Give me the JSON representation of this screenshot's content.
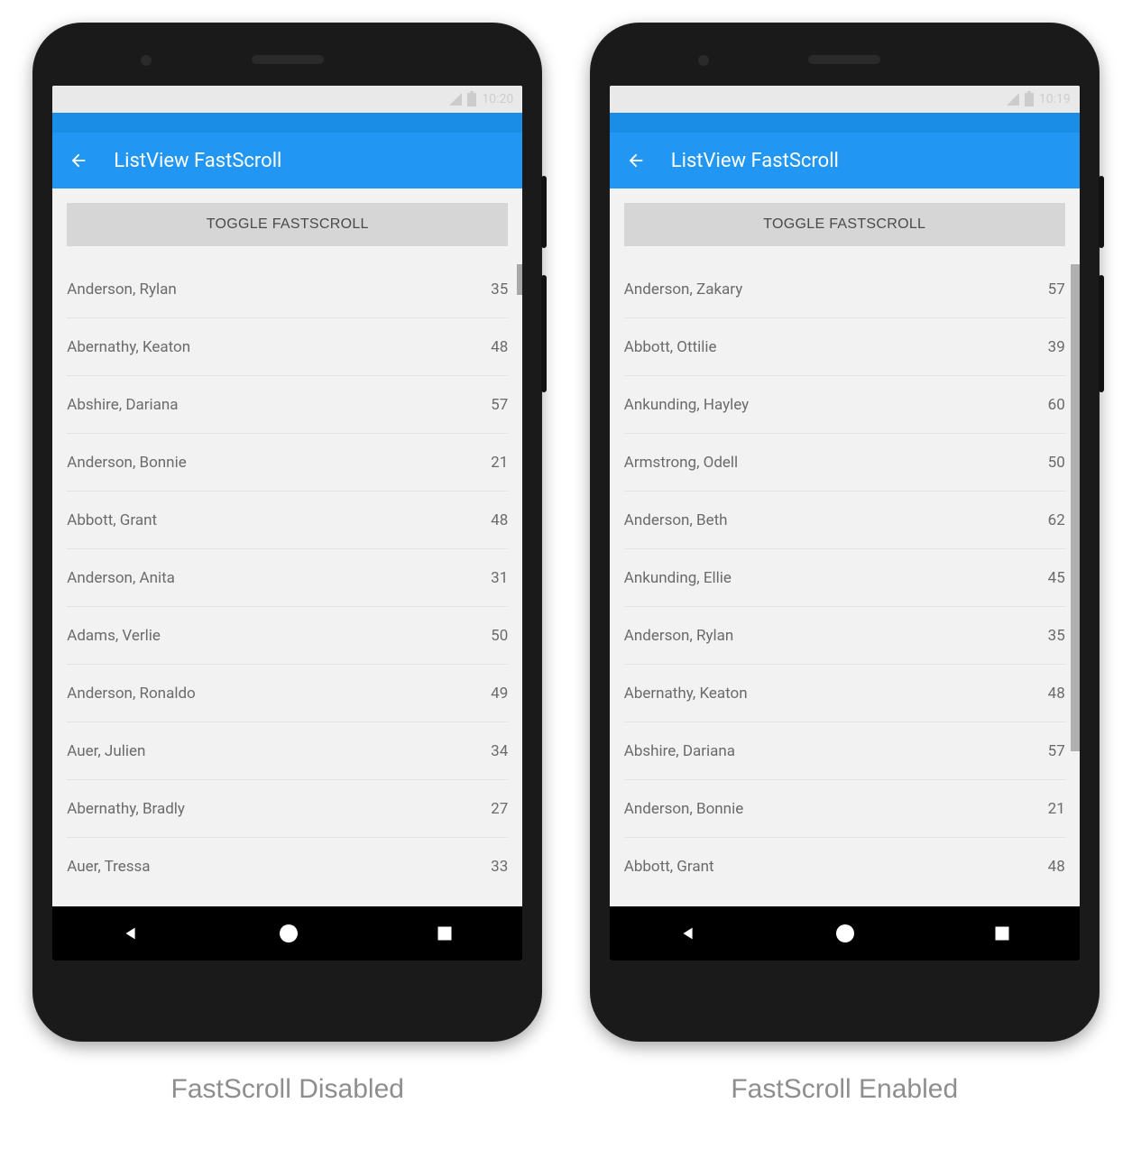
{
  "phones": [
    {
      "statusbar_time": "10:20",
      "app_title": "ListView FastScroll",
      "toggle_label": "TOGGLE FASTSCROLL",
      "scroll_style": "thin",
      "list": [
        {
          "name": "Anderson, Rylan",
          "value": "35"
        },
        {
          "name": "Abernathy, Keaton",
          "value": "48"
        },
        {
          "name": "Abshire, Dariana",
          "value": "57"
        },
        {
          "name": "Anderson, Bonnie",
          "value": "21"
        },
        {
          "name": "Abbott, Grant",
          "value": "48"
        },
        {
          "name": "Anderson, Anita",
          "value": "31"
        },
        {
          "name": "Adams, Verlie",
          "value": "50"
        },
        {
          "name": "Anderson, Ronaldo",
          "value": "49"
        },
        {
          "name": "Auer, Julien",
          "value": "34"
        },
        {
          "name": "Abernathy, Bradly",
          "value": "27"
        },
        {
          "name": "Auer, Tressa",
          "value": "33"
        }
      ],
      "caption": "FastScroll Disabled"
    },
    {
      "statusbar_time": "10:19",
      "app_title": "ListView FastScroll",
      "toggle_label": "TOGGLE FASTSCROLL",
      "scroll_style": "fat",
      "list": [
        {
          "name": "Anderson, Zakary",
          "value": "57"
        },
        {
          "name": "Abbott, Ottilie",
          "value": "39"
        },
        {
          "name": "Ankunding, Hayley",
          "value": "60"
        },
        {
          "name": "Armstrong, Odell",
          "value": "50"
        },
        {
          "name": "Anderson, Beth",
          "value": "62"
        },
        {
          "name": "Ankunding, Ellie",
          "value": "45"
        },
        {
          "name": "Anderson, Rylan",
          "value": "35"
        },
        {
          "name": "Abernathy, Keaton",
          "value": "48"
        },
        {
          "name": "Abshire, Dariana",
          "value": "57"
        },
        {
          "name": "Anderson, Bonnie",
          "value": "21"
        },
        {
          "name": "Abbott, Grant",
          "value": "48"
        }
      ],
      "caption": "FastScroll Enabled"
    }
  ]
}
